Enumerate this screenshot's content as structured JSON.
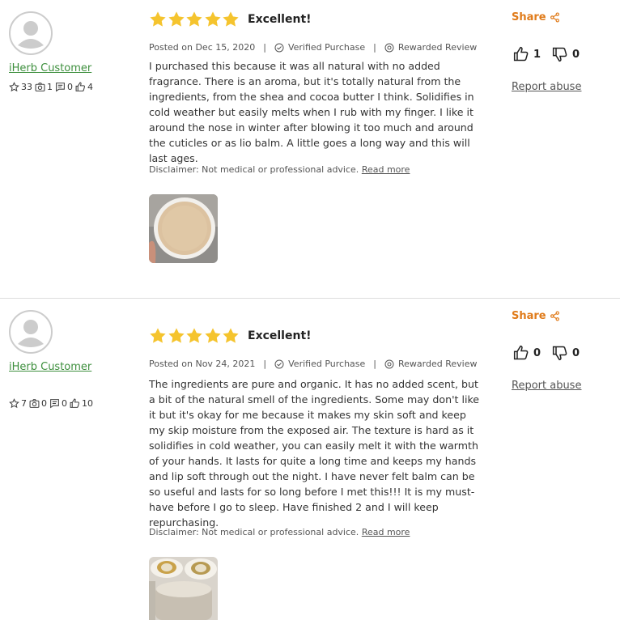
{
  "colors": {
    "star": "#f5c42e",
    "accent": "#e07b1a",
    "username": "#3d8f3d"
  },
  "reviews": [
    {
      "username": "iHerb Customer",
      "stats": {
        "stars": "33",
        "photos": "1",
        "comments": "0",
        "likes": "4"
      },
      "rating": 5,
      "headline": "Excellent!",
      "posted": "Posted on Dec 15, 2020",
      "verified": "Verified Purchase",
      "rewarded": "Rewarded Review",
      "body": "I purchased this because it was all natural with no added fragrance. There is an aroma, but it's totally natural from the ingredients, from the shea and cocoa butter I think. Solidifies in cold weather but easily melts when I rub with my finger. I like it around the nose in winter after blowing it too much and around the cuticles or as lio balm. A little goes a long way and this will last ages.",
      "disclaimer": "Disclaimer: Not medical or professional advice.",
      "read_more": "Read more",
      "share": "Share",
      "helpful": "1",
      "unhelpful": "0",
      "report": "Report abuse"
    },
    {
      "username": "iHerb Customer",
      "stats": {
        "stars": "7",
        "photos": "0",
        "comments": "0",
        "likes": "10"
      },
      "rating": 5,
      "headline": "Excellent!",
      "posted": "Posted on Nov 24, 2021",
      "verified": "Verified Purchase",
      "rewarded": "Rewarded Review",
      "body": "The ingredients are pure and organic. It has no added scent, but a bit of the natural smell of the ingredients. Some may don't like it but it's okay for me because it makes my skin soft and keep my skip moisture from the exposed air. The texture is hard as it solidifies in cold weather, you can easily melt it with the warmth of your hands. It lasts for quite a long time and keeps my hands and lip soft through out the night. I have never felt balm can be so useful and lasts for so long before I met this!!! It is my must-have before I go to sleep. Have finished 2 and I will keep repurchasing.",
      "disclaimer": "Disclaimer: Not medical or professional advice.",
      "read_more": "Read more",
      "share": "Share",
      "helpful": "0",
      "unhelpful": "0",
      "report": "Report abuse"
    }
  ]
}
